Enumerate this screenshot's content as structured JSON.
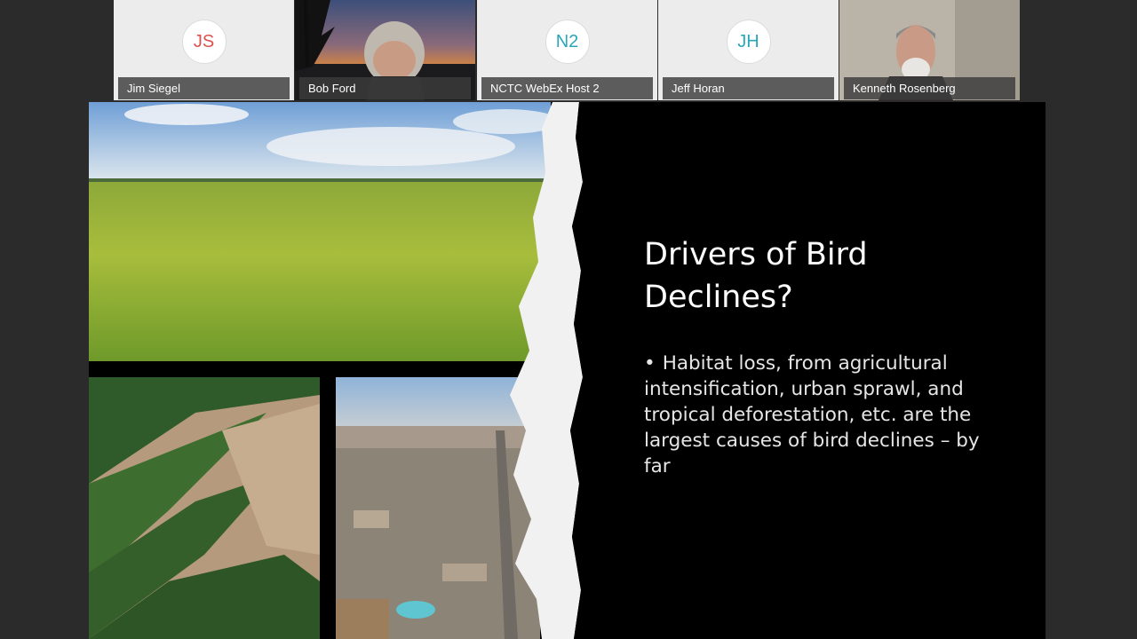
{
  "participants": [
    {
      "name": "Jim Siegel",
      "initials": "JS",
      "initials_color": "#d9534f",
      "has_video": false
    },
    {
      "name": "Bob Ford",
      "initials": "",
      "has_video": true
    },
    {
      "name": "NCTC WebEx Host 2",
      "initials": "N2",
      "initials_color": "#2aa6b8",
      "has_video": false
    },
    {
      "name": "Jeff Horan",
      "initials": "JH",
      "initials_color": "#2aa6b8",
      "has_video": false
    },
    {
      "name": "Kenneth Rosenberg",
      "initials": "",
      "has_video": true
    }
  ],
  "slide": {
    "title": "Drivers of Bird Declines?",
    "bullet_marker": "•",
    "bullet": "Habitat loss, from agricultural intensification, urban sprawl, and tropical deforestation, etc. are the largest causes of bird declines – by far"
  }
}
